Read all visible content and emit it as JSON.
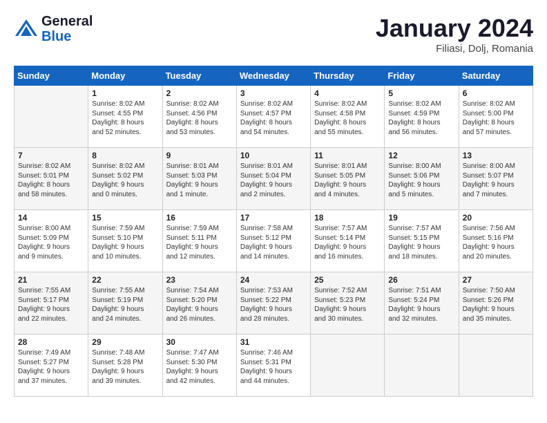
{
  "header": {
    "logo_line1": "General",
    "logo_line2": "Blue",
    "month": "January 2024",
    "location": "Filiasi, Dolj, Romania"
  },
  "weekdays": [
    "Sunday",
    "Monday",
    "Tuesday",
    "Wednesday",
    "Thursday",
    "Friday",
    "Saturday"
  ],
  "weeks": [
    [
      {
        "day": null,
        "info": null
      },
      {
        "day": "1",
        "info": "Sunrise: 8:02 AM\nSunset: 4:55 PM\nDaylight: 8 hours\nand 52 minutes."
      },
      {
        "day": "2",
        "info": "Sunrise: 8:02 AM\nSunset: 4:56 PM\nDaylight: 8 hours\nand 53 minutes."
      },
      {
        "day": "3",
        "info": "Sunrise: 8:02 AM\nSunset: 4:57 PM\nDaylight: 8 hours\nand 54 minutes."
      },
      {
        "day": "4",
        "info": "Sunrise: 8:02 AM\nSunset: 4:58 PM\nDaylight: 8 hours\nand 55 minutes."
      },
      {
        "day": "5",
        "info": "Sunrise: 8:02 AM\nSunset: 4:59 PM\nDaylight: 8 hours\nand 56 minutes."
      },
      {
        "day": "6",
        "info": "Sunrise: 8:02 AM\nSunset: 5:00 PM\nDaylight: 8 hours\nand 57 minutes."
      }
    ],
    [
      {
        "day": "7",
        "info": "Sunrise: 8:02 AM\nSunset: 5:01 PM\nDaylight: 8 hours\nand 58 minutes."
      },
      {
        "day": "8",
        "info": "Sunrise: 8:02 AM\nSunset: 5:02 PM\nDaylight: 9 hours\nand 0 minutes."
      },
      {
        "day": "9",
        "info": "Sunrise: 8:01 AM\nSunset: 5:03 PM\nDaylight: 9 hours\nand 1 minute."
      },
      {
        "day": "10",
        "info": "Sunrise: 8:01 AM\nSunset: 5:04 PM\nDaylight: 9 hours\nand 2 minutes."
      },
      {
        "day": "11",
        "info": "Sunrise: 8:01 AM\nSunset: 5:05 PM\nDaylight: 9 hours\nand 4 minutes."
      },
      {
        "day": "12",
        "info": "Sunrise: 8:00 AM\nSunset: 5:06 PM\nDaylight: 9 hours\nand 5 minutes."
      },
      {
        "day": "13",
        "info": "Sunrise: 8:00 AM\nSunset: 5:07 PM\nDaylight: 9 hours\nand 7 minutes."
      }
    ],
    [
      {
        "day": "14",
        "info": "Sunrise: 8:00 AM\nSunset: 5:09 PM\nDaylight: 9 hours\nand 9 minutes."
      },
      {
        "day": "15",
        "info": "Sunrise: 7:59 AM\nSunset: 5:10 PM\nDaylight: 9 hours\nand 10 minutes."
      },
      {
        "day": "16",
        "info": "Sunrise: 7:59 AM\nSunset: 5:11 PM\nDaylight: 9 hours\nand 12 minutes."
      },
      {
        "day": "17",
        "info": "Sunrise: 7:58 AM\nSunset: 5:12 PM\nDaylight: 9 hours\nand 14 minutes."
      },
      {
        "day": "18",
        "info": "Sunrise: 7:57 AM\nSunset: 5:14 PM\nDaylight: 9 hours\nand 16 minutes."
      },
      {
        "day": "19",
        "info": "Sunrise: 7:57 AM\nSunset: 5:15 PM\nDaylight: 9 hours\nand 18 minutes."
      },
      {
        "day": "20",
        "info": "Sunrise: 7:56 AM\nSunset: 5:16 PM\nDaylight: 9 hours\nand 20 minutes."
      }
    ],
    [
      {
        "day": "21",
        "info": "Sunrise: 7:55 AM\nSunset: 5:17 PM\nDaylight: 9 hours\nand 22 minutes."
      },
      {
        "day": "22",
        "info": "Sunrise: 7:55 AM\nSunset: 5:19 PM\nDaylight: 9 hours\nand 24 minutes."
      },
      {
        "day": "23",
        "info": "Sunrise: 7:54 AM\nSunset: 5:20 PM\nDaylight: 9 hours\nand 26 minutes."
      },
      {
        "day": "24",
        "info": "Sunrise: 7:53 AM\nSunset: 5:22 PM\nDaylight: 9 hours\nand 28 minutes."
      },
      {
        "day": "25",
        "info": "Sunrise: 7:52 AM\nSunset: 5:23 PM\nDaylight: 9 hours\nand 30 minutes."
      },
      {
        "day": "26",
        "info": "Sunrise: 7:51 AM\nSunset: 5:24 PM\nDaylight: 9 hours\nand 32 minutes."
      },
      {
        "day": "27",
        "info": "Sunrise: 7:50 AM\nSunset: 5:26 PM\nDaylight: 9 hours\nand 35 minutes."
      }
    ],
    [
      {
        "day": "28",
        "info": "Sunrise: 7:49 AM\nSunset: 5:27 PM\nDaylight: 9 hours\nand 37 minutes."
      },
      {
        "day": "29",
        "info": "Sunrise: 7:48 AM\nSunset: 5:28 PM\nDaylight: 9 hours\nand 39 minutes."
      },
      {
        "day": "30",
        "info": "Sunrise: 7:47 AM\nSunset: 5:30 PM\nDaylight: 9 hours\nand 42 minutes."
      },
      {
        "day": "31",
        "info": "Sunrise: 7:46 AM\nSunset: 5:31 PM\nDaylight: 9 hours\nand 44 minutes."
      },
      {
        "day": null,
        "info": null
      },
      {
        "day": null,
        "info": null
      },
      {
        "day": null,
        "info": null
      }
    ]
  ]
}
